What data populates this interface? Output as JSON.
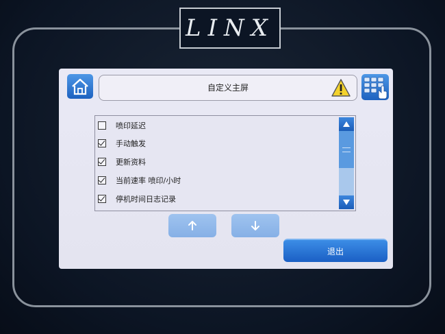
{
  "brand": {
    "logo_text": "LINX"
  },
  "header": {
    "title": "自定义主屏",
    "home_icon": "home-icon",
    "warning_icon": "warning-icon",
    "keypad_icon": "keypad-icon",
    "accent": "#1d62c0"
  },
  "list": {
    "items": [
      {
        "label": "喷印延迟",
        "checked": false
      },
      {
        "label": "手动触发",
        "checked": true
      },
      {
        "label": "更新资料",
        "checked": true
      },
      {
        "label": "当前速率 喷印/小时",
        "checked": true
      },
      {
        "label": "停机时间日志记录",
        "checked": true
      }
    ]
  },
  "nav": {
    "up_icon": "arrow-up-icon",
    "down_icon": "arrow-down-icon"
  },
  "footer": {
    "exit_label": "退出"
  }
}
